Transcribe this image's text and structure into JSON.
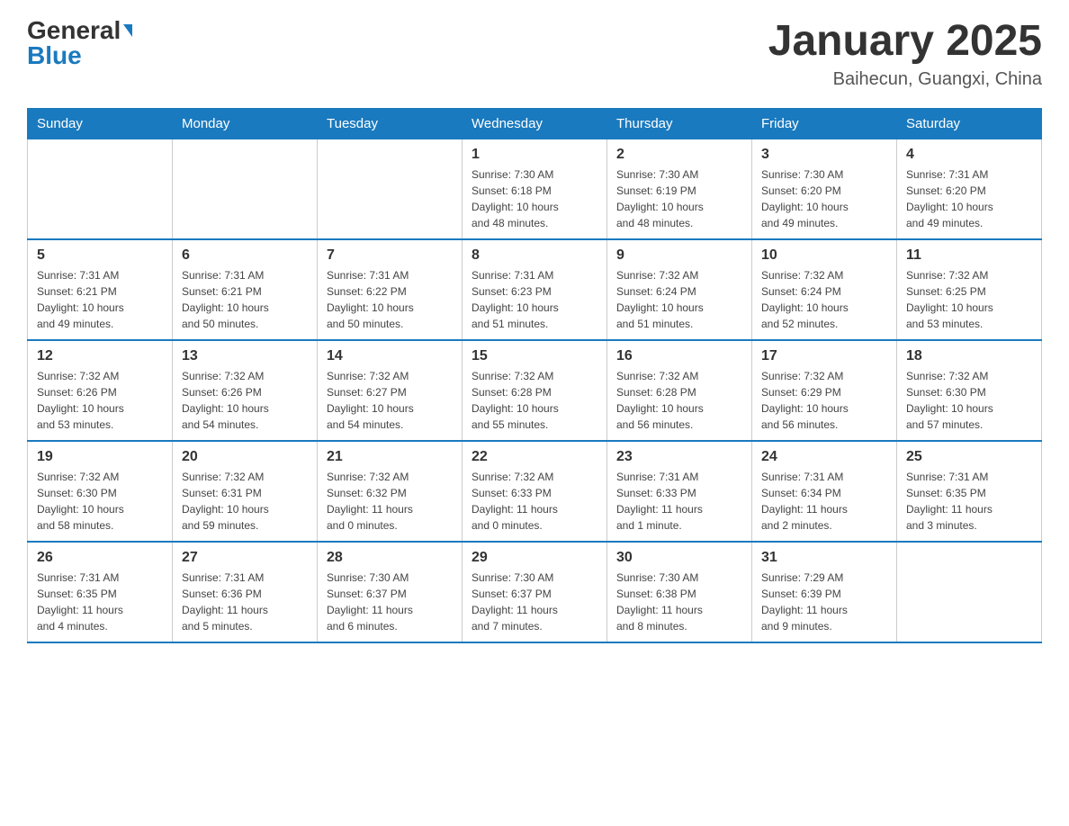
{
  "header": {
    "logo_general": "General",
    "logo_blue": "Blue",
    "month_title": "January 2025",
    "location": "Baihecun, Guangxi, China"
  },
  "days_of_week": [
    "Sunday",
    "Monday",
    "Tuesday",
    "Wednesday",
    "Thursday",
    "Friday",
    "Saturday"
  ],
  "weeks": [
    [
      {
        "day": "",
        "info": ""
      },
      {
        "day": "",
        "info": ""
      },
      {
        "day": "",
        "info": ""
      },
      {
        "day": "1",
        "info": "Sunrise: 7:30 AM\nSunset: 6:18 PM\nDaylight: 10 hours\nand 48 minutes."
      },
      {
        "day": "2",
        "info": "Sunrise: 7:30 AM\nSunset: 6:19 PM\nDaylight: 10 hours\nand 48 minutes."
      },
      {
        "day": "3",
        "info": "Sunrise: 7:30 AM\nSunset: 6:20 PM\nDaylight: 10 hours\nand 49 minutes."
      },
      {
        "day": "4",
        "info": "Sunrise: 7:31 AM\nSunset: 6:20 PM\nDaylight: 10 hours\nand 49 minutes."
      }
    ],
    [
      {
        "day": "5",
        "info": "Sunrise: 7:31 AM\nSunset: 6:21 PM\nDaylight: 10 hours\nand 49 minutes."
      },
      {
        "day": "6",
        "info": "Sunrise: 7:31 AM\nSunset: 6:21 PM\nDaylight: 10 hours\nand 50 minutes."
      },
      {
        "day": "7",
        "info": "Sunrise: 7:31 AM\nSunset: 6:22 PM\nDaylight: 10 hours\nand 50 minutes."
      },
      {
        "day": "8",
        "info": "Sunrise: 7:31 AM\nSunset: 6:23 PM\nDaylight: 10 hours\nand 51 minutes."
      },
      {
        "day": "9",
        "info": "Sunrise: 7:32 AM\nSunset: 6:24 PM\nDaylight: 10 hours\nand 51 minutes."
      },
      {
        "day": "10",
        "info": "Sunrise: 7:32 AM\nSunset: 6:24 PM\nDaylight: 10 hours\nand 52 minutes."
      },
      {
        "day": "11",
        "info": "Sunrise: 7:32 AM\nSunset: 6:25 PM\nDaylight: 10 hours\nand 53 minutes."
      }
    ],
    [
      {
        "day": "12",
        "info": "Sunrise: 7:32 AM\nSunset: 6:26 PM\nDaylight: 10 hours\nand 53 minutes."
      },
      {
        "day": "13",
        "info": "Sunrise: 7:32 AM\nSunset: 6:26 PM\nDaylight: 10 hours\nand 54 minutes."
      },
      {
        "day": "14",
        "info": "Sunrise: 7:32 AM\nSunset: 6:27 PM\nDaylight: 10 hours\nand 54 minutes."
      },
      {
        "day": "15",
        "info": "Sunrise: 7:32 AM\nSunset: 6:28 PM\nDaylight: 10 hours\nand 55 minutes."
      },
      {
        "day": "16",
        "info": "Sunrise: 7:32 AM\nSunset: 6:28 PM\nDaylight: 10 hours\nand 56 minutes."
      },
      {
        "day": "17",
        "info": "Sunrise: 7:32 AM\nSunset: 6:29 PM\nDaylight: 10 hours\nand 56 minutes."
      },
      {
        "day": "18",
        "info": "Sunrise: 7:32 AM\nSunset: 6:30 PM\nDaylight: 10 hours\nand 57 minutes."
      }
    ],
    [
      {
        "day": "19",
        "info": "Sunrise: 7:32 AM\nSunset: 6:30 PM\nDaylight: 10 hours\nand 58 minutes."
      },
      {
        "day": "20",
        "info": "Sunrise: 7:32 AM\nSunset: 6:31 PM\nDaylight: 10 hours\nand 59 minutes."
      },
      {
        "day": "21",
        "info": "Sunrise: 7:32 AM\nSunset: 6:32 PM\nDaylight: 11 hours\nand 0 minutes."
      },
      {
        "day": "22",
        "info": "Sunrise: 7:32 AM\nSunset: 6:33 PM\nDaylight: 11 hours\nand 0 minutes."
      },
      {
        "day": "23",
        "info": "Sunrise: 7:31 AM\nSunset: 6:33 PM\nDaylight: 11 hours\nand 1 minute."
      },
      {
        "day": "24",
        "info": "Sunrise: 7:31 AM\nSunset: 6:34 PM\nDaylight: 11 hours\nand 2 minutes."
      },
      {
        "day": "25",
        "info": "Sunrise: 7:31 AM\nSunset: 6:35 PM\nDaylight: 11 hours\nand 3 minutes."
      }
    ],
    [
      {
        "day": "26",
        "info": "Sunrise: 7:31 AM\nSunset: 6:35 PM\nDaylight: 11 hours\nand 4 minutes."
      },
      {
        "day": "27",
        "info": "Sunrise: 7:31 AM\nSunset: 6:36 PM\nDaylight: 11 hours\nand 5 minutes."
      },
      {
        "day": "28",
        "info": "Sunrise: 7:30 AM\nSunset: 6:37 PM\nDaylight: 11 hours\nand 6 minutes."
      },
      {
        "day": "29",
        "info": "Sunrise: 7:30 AM\nSunset: 6:37 PM\nDaylight: 11 hours\nand 7 minutes."
      },
      {
        "day": "30",
        "info": "Sunrise: 7:30 AM\nSunset: 6:38 PM\nDaylight: 11 hours\nand 8 minutes."
      },
      {
        "day": "31",
        "info": "Sunrise: 7:29 AM\nSunset: 6:39 PM\nDaylight: 11 hours\nand 9 minutes."
      },
      {
        "day": "",
        "info": ""
      }
    ]
  ]
}
